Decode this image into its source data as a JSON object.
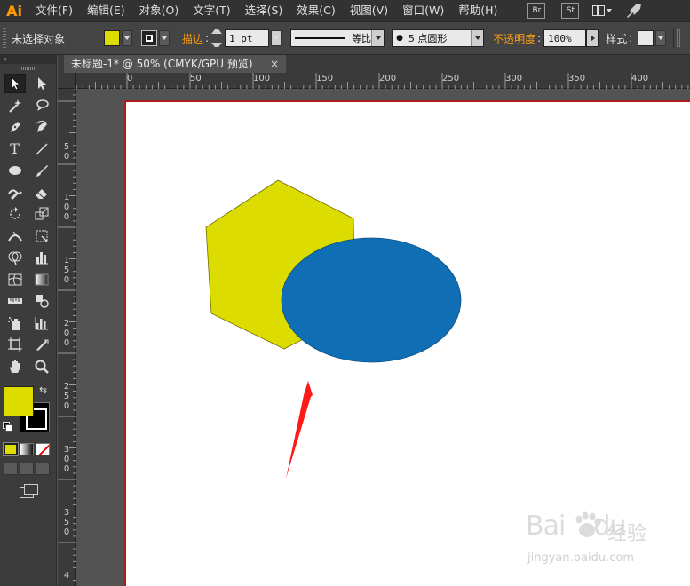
{
  "app": {
    "logo": "Ai"
  },
  "menubar": {
    "items": [
      "文件(F)",
      "编辑(E)",
      "对象(O)",
      "文字(T)",
      "选择(S)",
      "效果(C)",
      "视图(V)",
      "窗口(W)",
      "帮助(H)"
    ],
    "bridge_btn": "Br",
    "stock_btn": "St"
  },
  "controlbar": {
    "selection_label": "未选择对象",
    "fill_color": "#dcdc00",
    "stroke_label": "描边",
    "stroke_weight": "1 pt",
    "stroke_profile": "等比",
    "brush": "5 点圆形",
    "opacity_label": "不透明度",
    "opacity_value": "100%",
    "style_label": "样式"
  },
  "document": {
    "tab_title": "未标题-1* @ 50% (CMYK/GPU 预览)",
    "close_glyph": "×"
  },
  "rulers": {
    "top_labels": [
      "0",
      "50",
      "100",
      "150",
      "200",
      "250",
      "300",
      "350",
      "400"
    ],
    "left_labels": [
      "50",
      "100",
      "150",
      "200",
      "250",
      "300",
      "350",
      "4"
    ]
  },
  "canvas": {
    "hexagon_color": "#dcdc00",
    "ellipse_color": "#106eb5",
    "arrow_color": "#ff1a1a"
  },
  "toolbox": {
    "fill_color": "#dcdc00",
    "stroke_color": "#000000"
  },
  "watermark": {
    "brand": "Bai",
    "brand_suffix": "du",
    "cn": "经验",
    "url": "jingyan.baidu.com"
  }
}
